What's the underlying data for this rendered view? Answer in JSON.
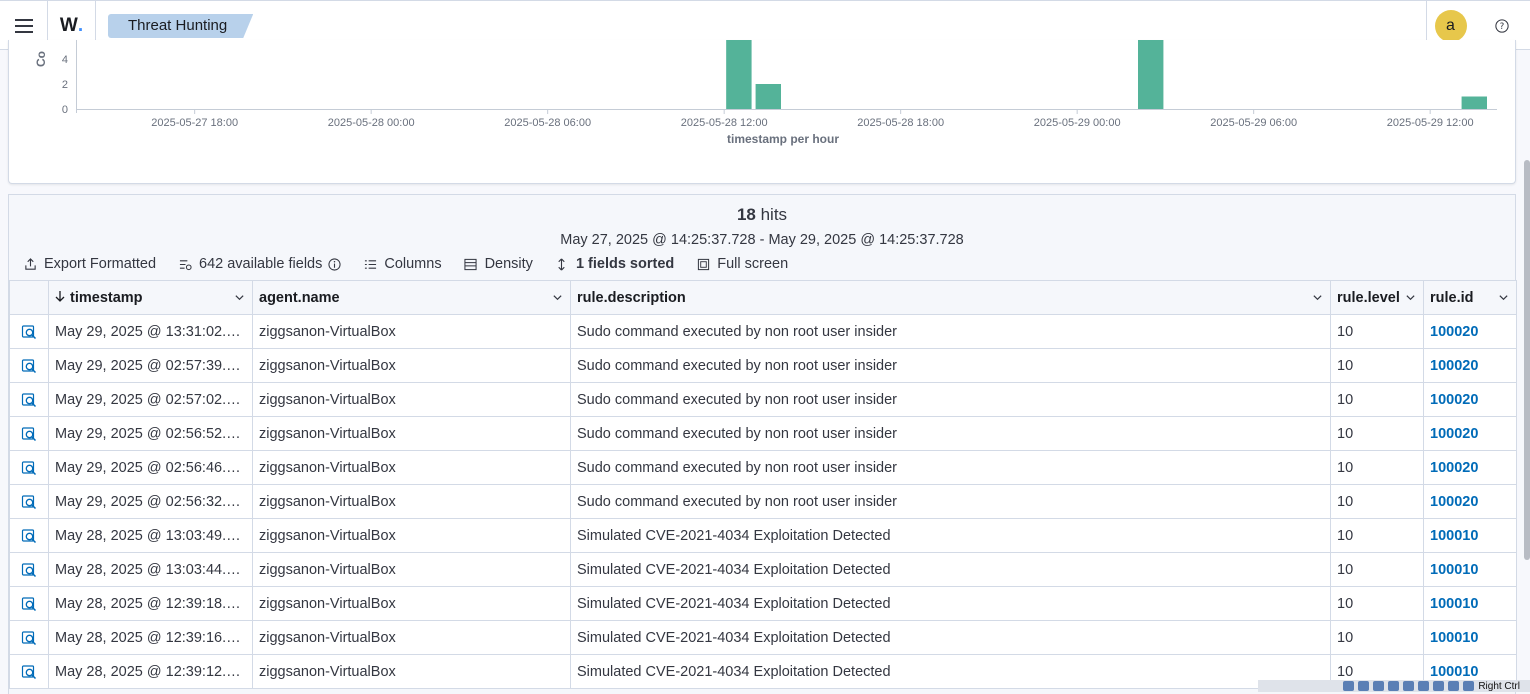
{
  "header": {
    "logo": "W",
    "breadcrumb": "Threat Hunting",
    "avatar_letter": "a"
  },
  "chart_data": {
    "type": "bar",
    "xlabel": "timestamp per hour",
    "ylabel": "Co",
    "yticks": [
      "0",
      "2",
      "4"
    ],
    "xticks": [
      "2025-05-27 18:00",
      "2025-05-28 00:00",
      "2025-05-28 06:00",
      "2025-05-28 12:00",
      "2025-05-28 18:00",
      "2025-05-29 00:00",
      "2025-05-29 06:00",
      "2025-05-29 12:00"
    ],
    "x_range": [
      "2025-05-27 14:00",
      "2025-05-29 14:00"
    ],
    "bars": [
      {
        "x": "2025-05-28 12:00",
        "y": 6
      },
      {
        "x": "2025-05-28 13:00",
        "y": 2
      },
      {
        "x": "2025-05-29 02:00",
        "y": 6
      },
      {
        "x": "2025-05-29 13:00",
        "y": 1
      }
    ],
    "color": "#54b399"
  },
  "results": {
    "hits_count": "18",
    "hits_label": "hits",
    "date_range": "May 27, 2025 @ 14:25:37.728 - May 29, 2025 @ 14:25:37.728",
    "toolbar": {
      "export": "Export Formatted",
      "fields": "642 available fields",
      "columns": "Columns",
      "density": "Density",
      "sorted": "1 fields sorted",
      "fullscreen": "Full screen"
    },
    "columns": [
      "timestamp",
      "agent.name",
      "rule.description",
      "rule.level",
      "rule.id"
    ],
    "rows": [
      [
        "May 29, 2025 @ 13:31:02.9...",
        "ziggsanon-VirtualBox",
        "Sudo command executed by non root user insider",
        "10",
        "100020"
      ],
      [
        "May 29, 2025 @ 02:57:39.0...",
        "ziggsanon-VirtualBox",
        "Sudo command executed by non root user insider",
        "10",
        "100020"
      ],
      [
        "May 29, 2025 @ 02:57:02.9...",
        "ziggsanon-VirtualBox",
        "Sudo command executed by non root user insider",
        "10",
        "100020"
      ],
      [
        "May 29, 2025 @ 02:56:52.9...",
        "ziggsanon-VirtualBox",
        "Sudo command executed by non root user insider",
        "10",
        "100020"
      ],
      [
        "May 29, 2025 @ 02:56:46.9...",
        "ziggsanon-VirtualBox",
        "Sudo command executed by non root user insider",
        "10",
        "100020"
      ],
      [
        "May 29, 2025 @ 02:56:32.9...",
        "ziggsanon-VirtualBox",
        "Sudo command executed by non root user insider",
        "10",
        "100020"
      ],
      [
        "May 28, 2025 @ 13:03:49.4...",
        "ziggsanon-VirtualBox",
        "Simulated CVE-2021-4034 Exploitation Detected",
        "10",
        "100010"
      ],
      [
        "May 28, 2025 @ 13:03:44.2...",
        "ziggsanon-VirtualBox",
        "Simulated CVE-2021-4034 Exploitation Detected",
        "10",
        "100010"
      ],
      [
        "May 28, 2025 @ 12:39:18.6...",
        "ziggsanon-VirtualBox",
        "Simulated CVE-2021-4034 Exploitation Detected",
        "10",
        "100010"
      ],
      [
        "May 28, 2025 @ 12:39:16.3...",
        "ziggsanon-VirtualBox",
        "Simulated CVE-2021-4034 Exploitation Detected",
        "10",
        "100010"
      ],
      [
        "May 28, 2025 @ 12:39:12.3...",
        "ziggsanon-VirtualBox",
        "Simulated CVE-2021-4034 Exploitation Detected",
        "10",
        "100010"
      ]
    ]
  },
  "statusbar": {
    "label": "Right Ctrl"
  }
}
